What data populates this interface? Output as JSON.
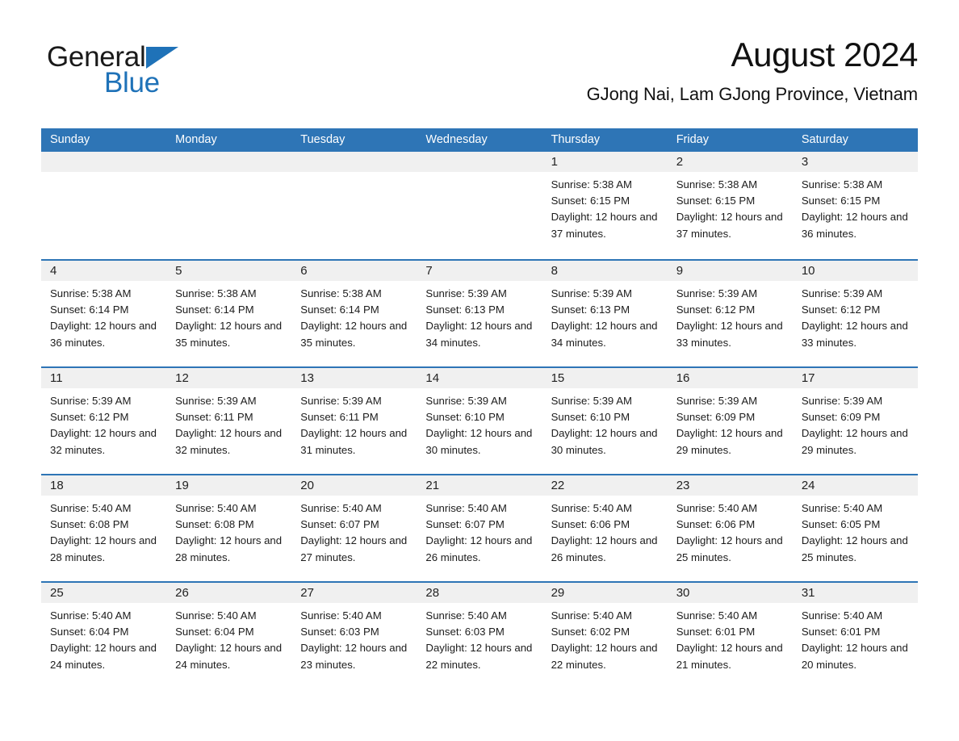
{
  "brand": {
    "name_part1": "General",
    "name_part2": "Blue",
    "triangle_color": "#1f72b8",
    "logo_icon": "general-blue-logo"
  },
  "header": {
    "month_title": "August 2024",
    "location": "GJong Nai, Lam GJong Province, Vietnam"
  },
  "theme": {
    "header_blue": "#2e75b6",
    "row_divider_blue": "#2e75b6",
    "day_band_gray": "#f0f0f0",
    "text_color": "#1c1c1c"
  },
  "calendar": {
    "weekdays": [
      "Sunday",
      "Monday",
      "Tuesday",
      "Wednesday",
      "Thursday",
      "Friday",
      "Saturday"
    ],
    "weeks": [
      [
        {
          "empty": true
        },
        {
          "empty": true
        },
        {
          "empty": true
        },
        {
          "empty": true
        },
        {
          "day": "1",
          "sunrise": "Sunrise: 5:38 AM",
          "sunset": "Sunset: 6:15 PM",
          "daylight": "Daylight: 12 hours and 37 minutes."
        },
        {
          "day": "2",
          "sunrise": "Sunrise: 5:38 AM",
          "sunset": "Sunset: 6:15 PM",
          "daylight": "Daylight: 12 hours and 37 minutes."
        },
        {
          "day": "3",
          "sunrise": "Sunrise: 5:38 AM",
          "sunset": "Sunset: 6:15 PM",
          "daylight": "Daylight: 12 hours and 36 minutes."
        }
      ],
      [
        {
          "day": "4",
          "sunrise": "Sunrise: 5:38 AM",
          "sunset": "Sunset: 6:14 PM",
          "daylight": "Daylight: 12 hours and 36 minutes."
        },
        {
          "day": "5",
          "sunrise": "Sunrise: 5:38 AM",
          "sunset": "Sunset: 6:14 PM",
          "daylight": "Daylight: 12 hours and 35 minutes."
        },
        {
          "day": "6",
          "sunrise": "Sunrise: 5:38 AM",
          "sunset": "Sunset: 6:14 PM",
          "daylight": "Daylight: 12 hours and 35 minutes."
        },
        {
          "day": "7",
          "sunrise": "Sunrise: 5:39 AM",
          "sunset": "Sunset: 6:13 PM",
          "daylight": "Daylight: 12 hours and 34 minutes."
        },
        {
          "day": "8",
          "sunrise": "Sunrise: 5:39 AM",
          "sunset": "Sunset: 6:13 PM",
          "daylight": "Daylight: 12 hours and 34 minutes."
        },
        {
          "day": "9",
          "sunrise": "Sunrise: 5:39 AM",
          "sunset": "Sunset: 6:12 PM",
          "daylight": "Daylight: 12 hours and 33 minutes."
        },
        {
          "day": "10",
          "sunrise": "Sunrise: 5:39 AM",
          "sunset": "Sunset: 6:12 PM",
          "daylight": "Daylight: 12 hours and 33 minutes."
        }
      ],
      [
        {
          "day": "11",
          "sunrise": "Sunrise: 5:39 AM",
          "sunset": "Sunset: 6:12 PM",
          "daylight": "Daylight: 12 hours and 32 minutes."
        },
        {
          "day": "12",
          "sunrise": "Sunrise: 5:39 AM",
          "sunset": "Sunset: 6:11 PM",
          "daylight": "Daylight: 12 hours and 32 minutes."
        },
        {
          "day": "13",
          "sunrise": "Sunrise: 5:39 AM",
          "sunset": "Sunset: 6:11 PM",
          "daylight": "Daylight: 12 hours and 31 minutes."
        },
        {
          "day": "14",
          "sunrise": "Sunrise: 5:39 AM",
          "sunset": "Sunset: 6:10 PM",
          "daylight": "Daylight: 12 hours and 30 minutes."
        },
        {
          "day": "15",
          "sunrise": "Sunrise: 5:39 AM",
          "sunset": "Sunset: 6:10 PM",
          "daylight": "Daylight: 12 hours and 30 minutes."
        },
        {
          "day": "16",
          "sunrise": "Sunrise: 5:39 AM",
          "sunset": "Sunset: 6:09 PM",
          "daylight": "Daylight: 12 hours and 29 minutes."
        },
        {
          "day": "17",
          "sunrise": "Sunrise: 5:39 AM",
          "sunset": "Sunset: 6:09 PM",
          "daylight": "Daylight: 12 hours and 29 minutes."
        }
      ],
      [
        {
          "day": "18",
          "sunrise": "Sunrise: 5:40 AM",
          "sunset": "Sunset: 6:08 PM",
          "daylight": "Daylight: 12 hours and 28 minutes."
        },
        {
          "day": "19",
          "sunrise": "Sunrise: 5:40 AM",
          "sunset": "Sunset: 6:08 PM",
          "daylight": "Daylight: 12 hours and 28 minutes."
        },
        {
          "day": "20",
          "sunrise": "Sunrise: 5:40 AM",
          "sunset": "Sunset: 6:07 PM",
          "daylight": "Daylight: 12 hours and 27 minutes."
        },
        {
          "day": "21",
          "sunrise": "Sunrise: 5:40 AM",
          "sunset": "Sunset: 6:07 PM",
          "daylight": "Daylight: 12 hours and 26 minutes."
        },
        {
          "day": "22",
          "sunrise": "Sunrise: 5:40 AM",
          "sunset": "Sunset: 6:06 PM",
          "daylight": "Daylight: 12 hours and 26 minutes."
        },
        {
          "day": "23",
          "sunrise": "Sunrise: 5:40 AM",
          "sunset": "Sunset: 6:06 PM",
          "daylight": "Daylight: 12 hours and 25 minutes."
        },
        {
          "day": "24",
          "sunrise": "Sunrise: 5:40 AM",
          "sunset": "Sunset: 6:05 PM",
          "daylight": "Daylight: 12 hours and 25 minutes."
        }
      ],
      [
        {
          "day": "25",
          "sunrise": "Sunrise: 5:40 AM",
          "sunset": "Sunset: 6:04 PM",
          "daylight": "Daylight: 12 hours and 24 minutes."
        },
        {
          "day": "26",
          "sunrise": "Sunrise: 5:40 AM",
          "sunset": "Sunset: 6:04 PM",
          "daylight": "Daylight: 12 hours and 24 minutes."
        },
        {
          "day": "27",
          "sunrise": "Sunrise: 5:40 AM",
          "sunset": "Sunset: 6:03 PM",
          "daylight": "Daylight: 12 hours and 23 minutes."
        },
        {
          "day": "28",
          "sunrise": "Sunrise: 5:40 AM",
          "sunset": "Sunset: 6:03 PM",
          "daylight": "Daylight: 12 hours and 22 minutes."
        },
        {
          "day": "29",
          "sunrise": "Sunrise: 5:40 AM",
          "sunset": "Sunset: 6:02 PM",
          "daylight": "Daylight: 12 hours and 22 minutes."
        },
        {
          "day": "30",
          "sunrise": "Sunrise: 5:40 AM",
          "sunset": "Sunset: 6:01 PM",
          "daylight": "Daylight: 12 hours and 21 minutes."
        },
        {
          "day": "31",
          "sunrise": "Sunrise: 5:40 AM",
          "sunset": "Sunset: 6:01 PM",
          "daylight": "Daylight: 12 hours and 20 minutes."
        }
      ]
    ]
  }
}
